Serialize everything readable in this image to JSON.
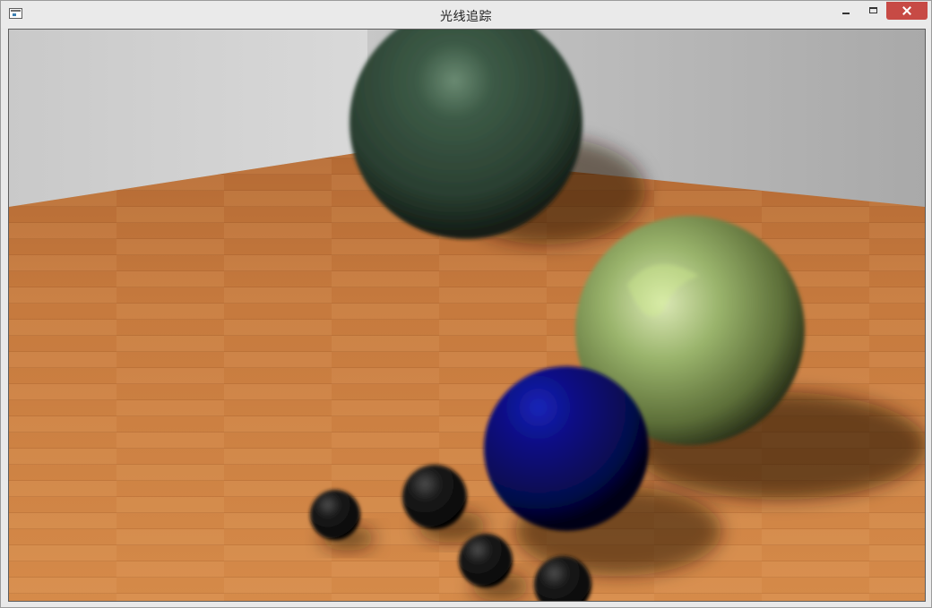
{
  "window": {
    "title": "光线追踪",
    "icon": "app-window-icon",
    "controls": [
      "minimize-icon",
      "maximize-icon",
      "close-icon"
    ]
  },
  "scene": {
    "colors": {
      "wall": "#c8c8c8",
      "floor": "#c97a3e",
      "sphere_green_dark": "#2c4a38",
      "sphere_marble": "#8aaa5a",
      "sphere_blue": "#0b0f7a",
      "sphere_black": "#111111"
    }
  }
}
